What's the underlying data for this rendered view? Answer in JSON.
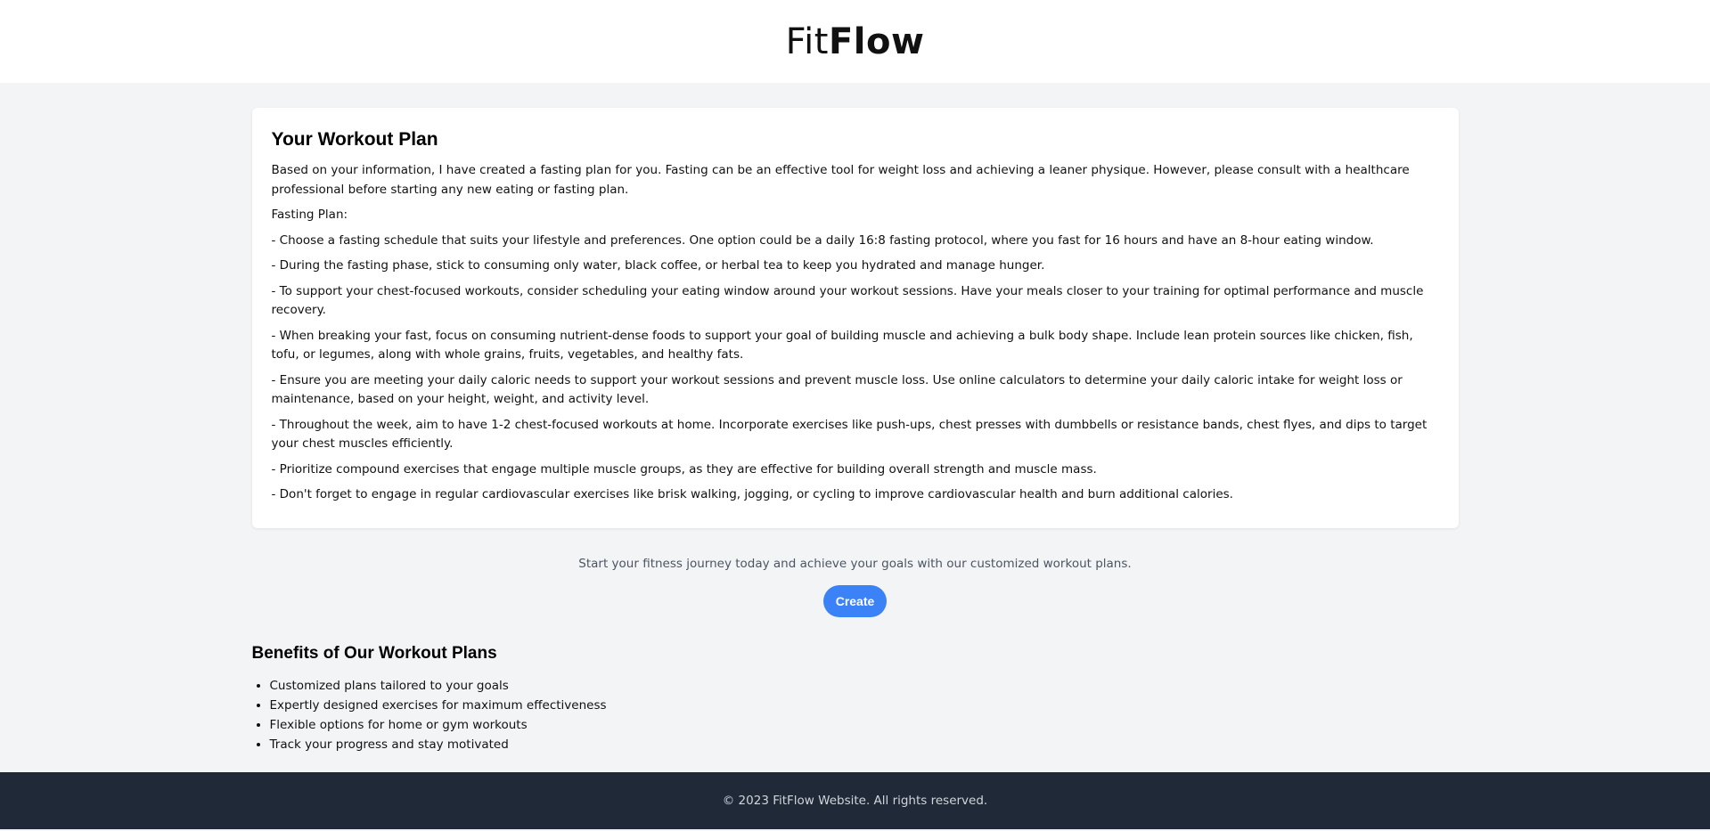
{
  "header": {
    "logo_light": "Fit",
    "logo_bold": "Flow"
  },
  "plan": {
    "title": "Your Workout Plan",
    "paragraphs": [
      "Based on your information, I have created a fasting plan for you. Fasting can be an effective tool for weight loss and achieving a leaner physique. However, please consult with a healthcare professional before starting any new eating or fasting plan.",
      "Fasting Plan:",
      "- Choose a fasting schedule that suits your lifestyle and preferences. One option could be a daily 16:8 fasting protocol, where you fast for 16 hours and have an 8-hour eating window.",
      "- During the fasting phase, stick to consuming only water, black coffee, or herbal tea to keep you hydrated and manage hunger.",
      "- To support your chest-focused workouts, consider scheduling your eating window around your workout sessions. Have your meals closer to your training for optimal performance and muscle recovery.",
      "- When breaking your fast, focus on consuming nutrient-dense foods to support your goal of building muscle and achieving a bulk body shape. Include lean protein sources like chicken, fish, tofu, or legumes, along with whole grains, fruits, vegetables, and healthy fats.",
      "- Ensure you are meeting your daily caloric needs to support your workout sessions and prevent muscle loss. Use online calculators to determine your daily caloric intake for weight loss or maintenance, based on your height, weight, and activity level.",
      "- Throughout the week, aim to have 1-2 chest-focused workouts at home. Incorporate exercises like push-ups, chest presses with dumbbells or resistance bands, chest flyes, and dips to target your chest muscles efficiently.",
      "- Prioritize compound exercises that engage multiple muscle groups, as they are effective for building overall strength and muscle mass.",
      "- Don't forget to engage in regular cardiovascular exercises like brisk walking, jogging, or cycling to improve cardiovascular health and burn additional calories."
    ]
  },
  "cta": {
    "text": "Start your fitness journey today and achieve your goals with our customized workout plans.",
    "button_label": "Create"
  },
  "benefits": {
    "title": "Benefits of Our Workout Plans",
    "items": [
      "Customized plans tailored to your goals",
      "Expertly designed exercises for maximum effectiveness",
      "Flexible options for home or gym workouts",
      "Track your progress and stay motivated"
    ]
  },
  "footer": {
    "text": "© 2023 FitFlow Website. All rights reserved."
  },
  "colors": {
    "accent": "#3b82f6",
    "page_bg": "#f3f4f6",
    "footer_bg": "#1f2937"
  }
}
